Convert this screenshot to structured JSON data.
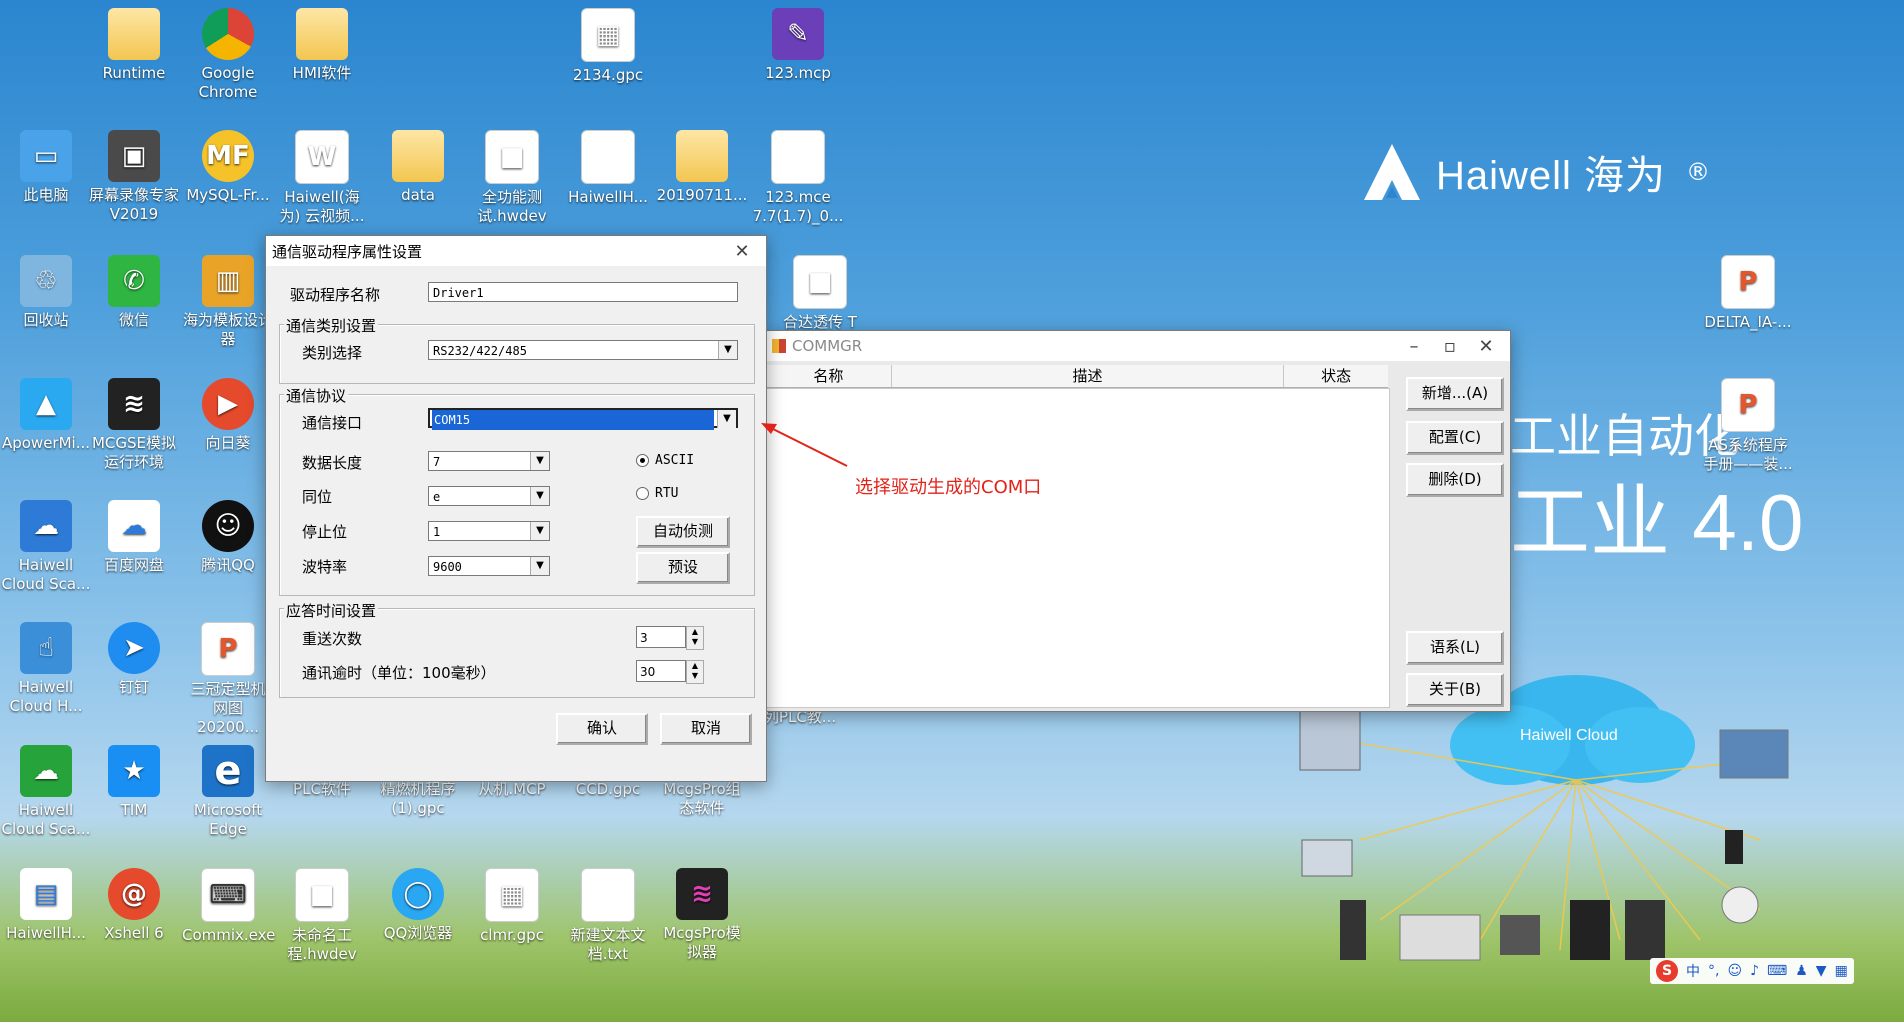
{
  "desktop": {
    "icons": [
      {
        "label": "Runtime",
        "kind": "folder",
        "glyph": ""
      },
      {
        "label": "Google Chrome",
        "kind": "app",
        "glyph": "◉"
      },
      {
        "label": "HMI软件",
        "kind": "folder",
        "glyph": ""
      },
      {
        "label": "2134.gpc",
        "kind": "doc",
        "glyph": "▦"
      },
      {
        "label": "123.mcp",
        "kind": "app",
        "glyph": "✎"
      },
      {
        "label": "此电脑",
        "kind": "app",
        "glyph": "▭"
      },
      {
        "label": "屏幕录像专家 V2019",
        "kind": "app",
        "glyph": "▣"
      },
      {
        "label": "MySQL-Fr...",
        "kind": "yellow",
        "glyph": "MF"
      },
      {
        "label": "Haiwell(海为) 云视频...",
        "kind": "doc",
        "glyph": "W"
      },
      {
        "label": "data",
        "kind": "folder",
        "glyph": ""
      },
      {
        "label": "全功能测试.hwdev",
        "kind": "doc",
        "glyph": "■"
      },
      {
        "label": "HaiwellH...",
        "kind": "doc",
        "glyph": ""
      },
      {
        "label": "20190711...",
        "kind": "folder",
        "glyph": ""
      },
      {
        "label": "123.mce 7.7(1.7)_0...",
        "kind": "doc",
        "glyph": ""
      },
      {
        "label": "回收站",
        "kind": "app",
        "glyph": "♲"
      },
      {
        "label": "微信",
        "kind": "wechat",
        "glyph": "✆"
      },
      {
        "label": "海为模板设计器",
        "kind": "app",
        "glyph": "▥"
      },
      {
        "label": "ApowerMi...",
        "kind": "app",
        "glyph": "▲"
      },
      {
        "label": "MCGSE模拟运行环境",
        "kind": "dark",
        "glyph": "≋"
      },
      {
        "label": "向日葵",
        "kind": "red",
        "glyph": "▶"
      },
      {
        "label": "Haiwell Cloud Sca...",
        "kind": "app",
        "glyph": "☁"
      },
      {
        "label": "百度网盘",
        "kind": "app",
        "glyph": "☁"
      },
      {
        "label": "腾讯QQ",
        "kind": "app",
        "glyph": "☺"
      },
      {
        "label": "Haiwell Cloud H...",
        "kind": "app",
        "glyph": "☝"
      },
      {
        "label": "钉钉",
        "kind": "app",
        "glyph": "➤"
      },
      {
        "label": "三冠定型机 网图20200...",
        "kind": "doc",
        "glyph": "P"
      },
      {
        "label": "Haiwell Cloud Sca...",
        "kind": "green",
        "glyph": "☁"
      },
      {
        "label": "TIM",
        "kind": "app",
        "glyph": "★"
      },
      {
        "label": "Microsoft Edge",
        "kind": "app",
        "glyph": "e"
      },
      {
        "label": "PLC软件",
        "kind": "folder",
        "glyph": ""
      },
      {
        "label": "精燃机程序(1).gpc",
        "kind": "doc",
        "glyph": "▦"
      },
      {
        "label": "从机.MCP",
        "kind": "app",
        "glyph": "✎"
      },
      {
        "label": "CCD.gpc",
        "kind": "doc",
        "glyph": "▦"
      },
      {
        "label": "McgsPro组态软件",
        "kind": "app",
        "glyph": "▩"
      },
      {
        "label": "HaiwellH...",
        "kind": "app",
        "glyph": "▤"
      },
      {
        "label": "Xshell 6",
        "kind": "red",
        "glyph": "@"
      },
      {
        "label": "Commix.exe",
        "kind": "doc",
        "glyph": "⌨"
      },
      {
        "label": "未命名工程.hwdev",
        "kind": "doc",
        "glyph": "■"
      },
      {
        "label": "QQ浏览器",
        "kind": "app",
        "glyph": "◯"
      },
      {
        "label": "clmr.gpc",
        "kind": "doc",
        "glyph": "▦"
      },
      {
        "label": "新建文本文档.txt",
        "kind": "doc",
        "glyph": ""
      },
      {
        "label": "McgsPro模拟器",
        "kind": "dark",
        "glyph": "≋"
      },
      {
        "label": "DELTA_IA-...",
        "kind": "doc",
        "glyph": "P"
      },
      {
        "label": "AS系统程序手册——装...",
        "kind": "doc",
        "glyph": "P"
      }
    ],
    "brand": "Haiwell 海为",
    "brand_reg": "®",
    "slogan_line1": "工业自动化",
    "slogan_line2": "工业 4.0",
    "cloud_label": "Haiwell Cloud",
    "partial_label_1": "合达透传 T",
    "partial_label_2": "列PLC教..."
  },
  "commgr": {
    "title": "COMMGR",
    "columns": [
      "名称",
      "描述",
      "状态"
    ],
    "buttons": {
      "add": "新增...(A)",
      "config": "配置(C)",
      "delete": "删除(D)",
      "language": "语系(L)",
      "about": "关于(B)"
    }
  },
  "driver_dialog": {
    "title": "通信驱动程序属性设置",
    "driver_name_label": "驱动程序名称",
    "driver_name_value": "Driver1",
    "type_group": "通信类别设置",
    "type_label": "类别选择",
    "type_value": "RS232/422/485",
    "protocol_group": "通信协议",
    "port_label": "通信接口",
    "port_value": "COM15",
    "data_len_label": "数据长度",
    "data_len_value": "7",
    "parity_label": "同位",
    "parity_value": "e",
    "stop_label": "停止位",
    "stop_value": "1",
    "baud_label": "波特率",
    "baud_value": "9600",
    "mode_ascii": "ASCII",
    "mode_rtu": "RTU",
    "auto_detect": "自动侦测",
    "preset": "预设",
    "response_group": "应答时间设置",
    "retry_label": "重送次数",
    "retry_value": "3",
    "timeout_label": "通讯逾时（单位：100毫秒）",
    "timeout_value": "30",
    "ok": "确认",
    "cancel": "取消"
  },
  "annotation": "选择驱动生成的COM口",
  "tray": {
    "ime": "中",
    "sogou": "S"
  },
  "colors": {
    "selection": "#1a66d6",
    "annotation": "#e2231a"
  }
}
